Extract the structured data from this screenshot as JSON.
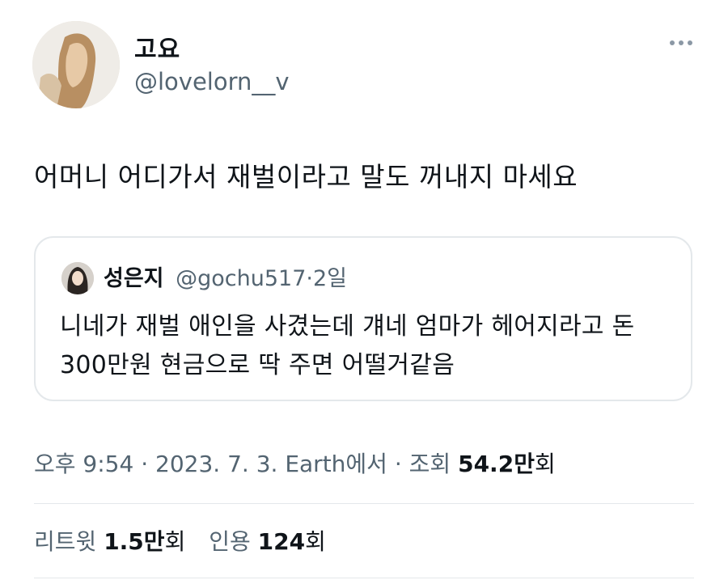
{
  "author": {
    "display_name": "고요",
    "handle": "@lovelorn__v"
  },
  "tweet_text": "어머니 어디가서 재벌이라고 말도 꺼내지 마세요",
  "quoted_tweet": {
    "display_name": "성은지",
    "handle": "@gochu517",
    "separator": "·",
    "time": "2일",
    "text": "니네가 재벌 애인을 사겼는데 걔네 엄마가 헤어지라고 돈 300만원 현금으로 딱 주면 어떨거같음"
  },
  "meta": {
    "time": "오후 9:54",
    "date": "2023. 7. 3.",
    "source": "Earth에서",
    "separator": "·",
    "views_label": "조회",
    "views_num": "54.2",
    "views_unit": "만",
    "views_suffix": "회"
  },
  "stats": {
    "retweets_label": "리트윗",
    "retweets_num": "1.5",
    "retweets_unit": "만",
    "retweets_suffix": "회",
    "quotes_label": "인용",
    "quotes_num": "124",
    "quotes_suffix": "회"
  },
  "icons": {
    "more": "more-horizontal-icon"
  },
  "colors": {
    "text": "#0f1419",
    "secondary": "#536471",
    "border": "#e4e8eb"
  }
}
